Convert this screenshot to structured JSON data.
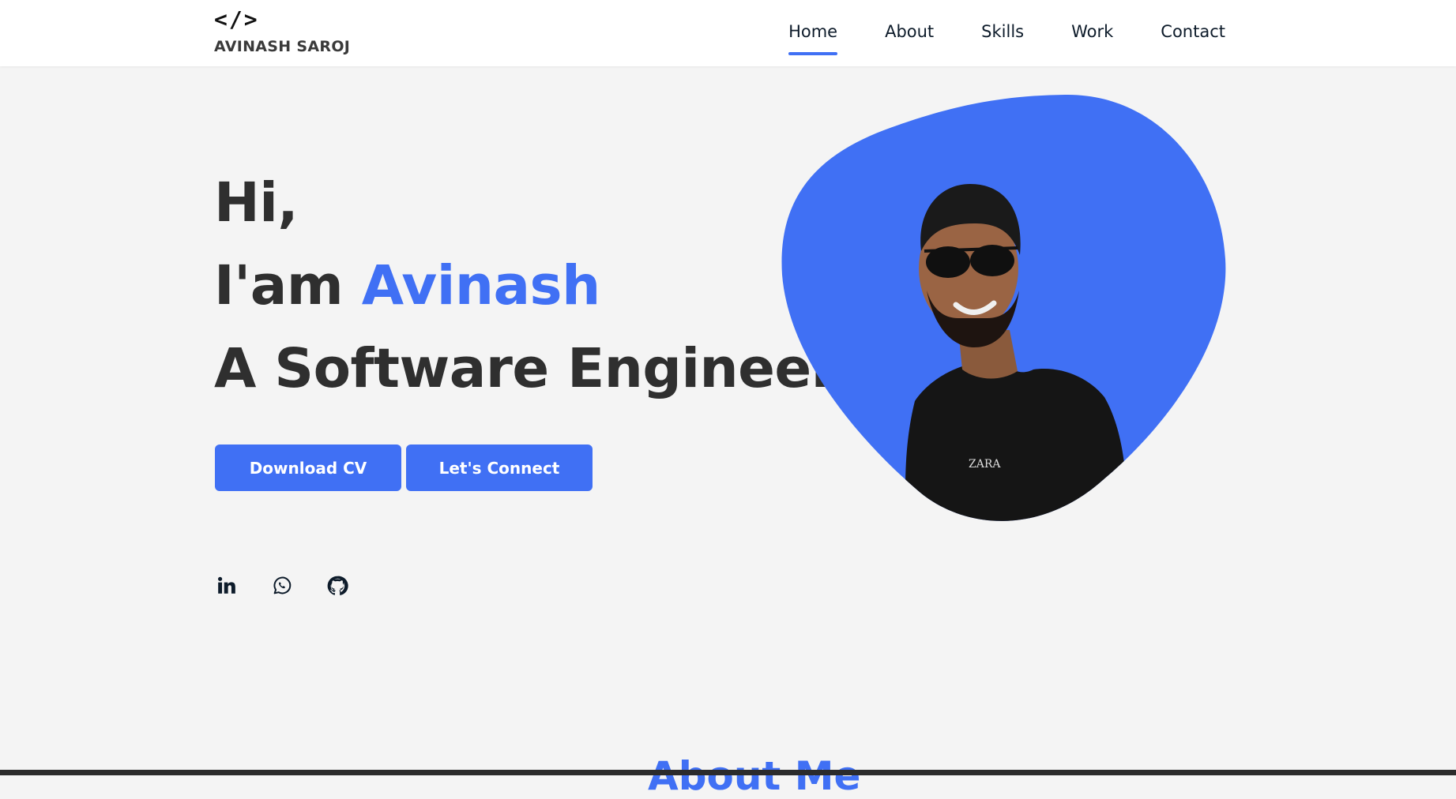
{
  "logo": {
    "mark": "</>",
    "name": "AVINASH SAROJ"
  },
  "nav": [
    {
      "label": "Home",
      "active": true
    },
    {
      "label": "About",
      "active": false
    },
    {
      "label": "Skills",
      "active": false
    },
    {
      "label": "Work",
      "active": false
    },
    {
      "label": "Contact",
      "active": false
    }
  ],
  "hero": {
    "line1": "Hi,",
    "line2_prefix": "I'am ",
    "line2_name": "Avinash",
    "line3": "A Software Engineer"
  },
  "buttons": {
    "download": "Download CV",
    "connect": "Let's Connect"
  },
  "socials": [
    "linkedin-icon",
    "whatsapp-icon",
    "github-icon"
  ],
  "photo": {
    "shirt_brand": "ZARA"
  },
  "next_section_heading_peek": "About Me",
  "colors": {
    "accent": "#4070f4",
    "background": "#f4f4f4",
    "text": "#2f2f2f"
  }
}
